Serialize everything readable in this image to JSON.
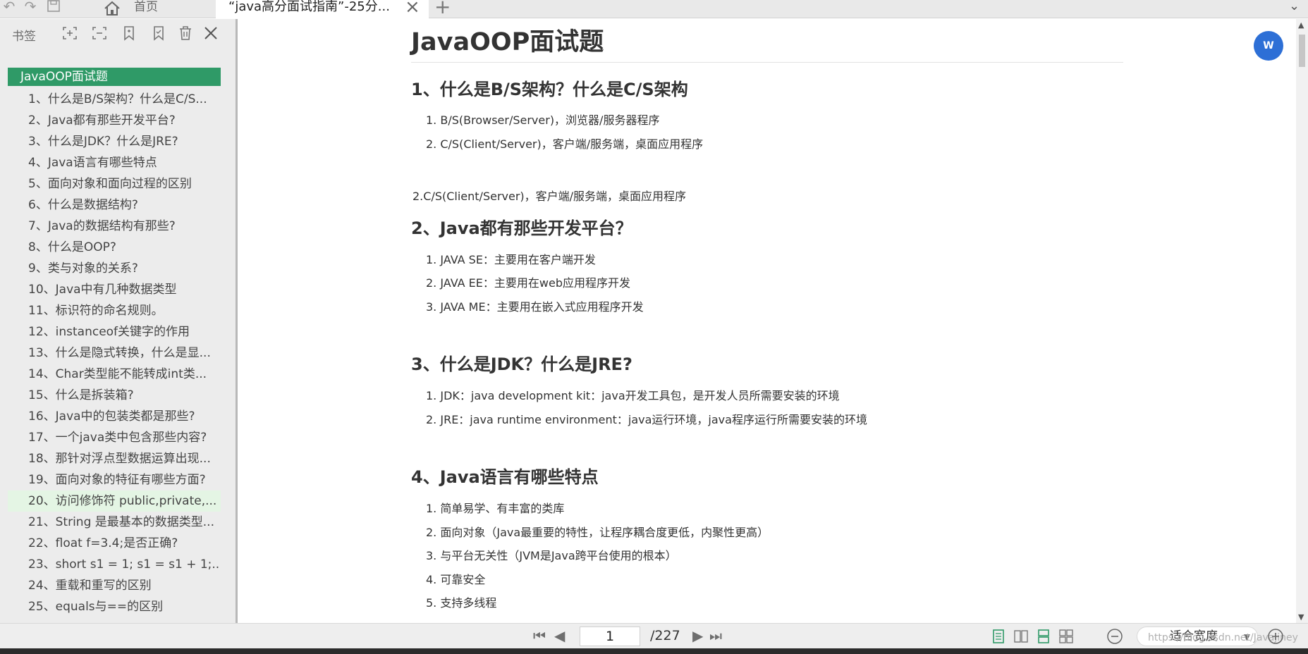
{
  "tabs": {
    "home_label": "首页",
    "doc_title": "“java高分面试指南”-25分..."
  },
  "sidebar": {
    "title": "书签",
    "items": [
      "JavaOOP面试题",
      "1、什么是B/S架构？什么是C/S...",
      "2、Java都有那些开发平台?",
      "3、什么是JDK？什么是JRE?",
      "4、Java语言有哪些特点",
      "5、面向对象和面向过程的区别",
      "6、什么是数据结构?",
      "7、Java的数据结构有那些?",
      "8、什么是OOP?",
      "9、类与对象的关系?",
      "10、Java中有几种数据类型",
      "11、标识符的命名规则。",
      "12、instanceof关键字的作用",
      "13、什么是隐式转换，什么是显...",
      "14、Char类型能不能转成int类...",
      "15、什么是拆装箱?",
      "16、Java中的包装类都是那些?",
      "17、一个java类中包含那些内容?",
      "18、那针对浮点型数据运算出现...",
      "19、面向对象的特征有哪些方面?",
      "20、访问修饰符 public,private,...",
      "21、String 是最基本的数据类型...",
      "22、float f=3.4;是否正确?",
      "23、short s1 = 1; s1 = s1 + 1;...",
      "24、重载和重写的区别",
      "25、equals与==的区别"
    ]
  },
  "content": {
    "title": "JavaOOP面试题",
    "s1": {
      "heading": "1、什么是B/S架构？什么是C/S架构",
      "items": [
        "1. B/S(Browser/Server)，浏览器/服务器程序",
        "2. C/S(Client/Server)，客户端/服务端，桌面应用程序"
      ],
      "trailing": "2.C/S(Client/Server)，客户端/服务端，桌面应用程序"
    },
    "s2": {
      "heading": "2、Java都有那些开发平台？",
      "items": [
        "1. JAVA SE：主要用在客户端开发",
        "2. JAVA EE：主要用在web应用程序开发",
        "3. JAVA ME：主要用在嵌入式应用程序开发"
      ]
    },
    "s3": {
      "heading": "3、什么是JDK？什么是JRE?",
      "items": [
        "1. JDK：java development kit：java开发工具包，是开发人员所需要安装的环境",
        "2. JRE：java runtime environment：java运行环境，java程序运行所需要安装的环境"
      ]
    },
    "s4": {
      "heading": "4、Java语言有哪些特点",
      "items": [
        "1. 简单易学、有丰富的类库",
        "2. 面向对象（Java最重要的特性，让程序耦合度更低，内聚性更高）",
        "3. 与平台无关性（JVM是Java跨平台使用的根本）",
        "4. 可靠安全",
        "5. 支持多线程"
      ]
    }
  },
  "statusbar": {
    "current_page": "1",
    "total_pages": "/227",
    "zoom_label": "适合宽度",
    "watermark": "https://blog.csdn.net/Javajiney"
  },
  "colors": {
    "accent_green": "#2f9a67",
    "highlight_green": "#e4f5e4",
    "translate_blue": "#2d6fd6"
  },
  "icons": {
    "translate_label": "W"
  }
}
